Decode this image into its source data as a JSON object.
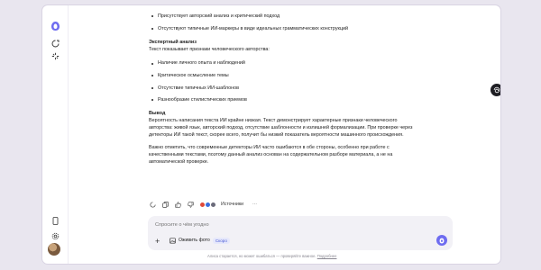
{
  "colors": {
    "accent": "#6e6cf0",
    "background": "#e9e6ef",
    "dark": "#1f1f24"
  },
  "sidebar": {
    "icons": [
      "alice-logo-icon",
      "new-chat-icon",
      "history-icon",
      "phone-icon",
      "settings-icon",
      "avatar"
    ]
  },
  "message": {
    "bullets_top": [
      "Присутствует авторский анализ и критический подход",
      "Отсутствуют типичные ИИ-маркеры в виде идеальных грамматических конструкций"
    ],
    "expert_title": "Экспертный анализ",
    "expert_intro": "Текст показывает признаки человеческого авторства:",
    "expert_bullets": [
      "Наличие личного опыта и наблюдений",
      "Критическое осмысление темы",
      "Отсутствие типичных ИИ-шаблонов",
      "Разнообразие стилистических приемов"
    ],
    "conclusion_title": "Вывод",
    "conclusion_p1": "Вероятность написания текста ИИ крайне низкая. Текст демонстрирует характерные признаки человеческого авторства: живой язык, авторский подход, отсутствие шаблонности и излишней формализации. При проверке через детекторы ИИ такой текст, скорее всего, получит бы низкий показатель вероятности машинного происхождения.",
    "conclusion_p2": "Важно отметить, что современные детекторы ИИ часто ошибаются в обе стороны, особенно при работе с качественными текстами, поэтому данный анализ основан на содержательном разборе материала, а не на автоматической проверке."
  },
  "actions": {
    "sources_label": "Источники",
    "more": "⋯"
  },
  "composer": {
    "placeholder": "Спросите о чём угодно",
    "revive_label": "Оживить фото",
    "revive_badge": "Скоро"
  },
  "footer": {
    "text": "Алиса старается, но может ошибаться — проверяйте важное.",
    "link": "Подробнее"
  }
}
